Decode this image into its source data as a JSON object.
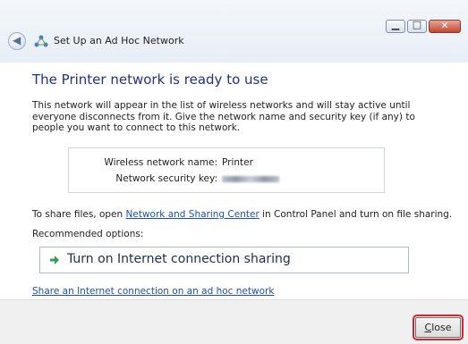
{
  "window": {
    "title": "Set Up an Ad Hoc Network",
    "controls": {
      "minimize_glyph": "▁",
      "maximize_glyph": "□",
      "close_glyph": "✕"
    }
  },
  "content": {
    "heading": "The Printer network is ready to use",
    "description": "This network will appear in the list of wireless networks and will stay active until everyone disconnects from it. Give the network name and security key (if any) to people you want to connect to this network.",
    "network": {
      "name_label": "Wireless network name:",
      "name_value": "Printer",
      "key_label": "Network security key:"
    },
    "share_text_before": "To share files, open ",
    "share_link": "Network and Sharing Center",
    "share_text_after": " in Control Panel and turn on file sharing.",
    "recommended_label": "Recommended options:",
    "option_label": "Turn on Internet connection sharing",
    "adhoc_link": "Share an Internet connection on an ad hoc network"
  },
  "footer": {
    "close_button_mnemonic": "C",
    "close_button_rest": "lose"
  },
  "colors": {
    "heading": "#1e3287",
    "link": "#1a4fb7",
    "highlight": "#d4262a",
    "arrow": "#2ca04a"
  }
}
